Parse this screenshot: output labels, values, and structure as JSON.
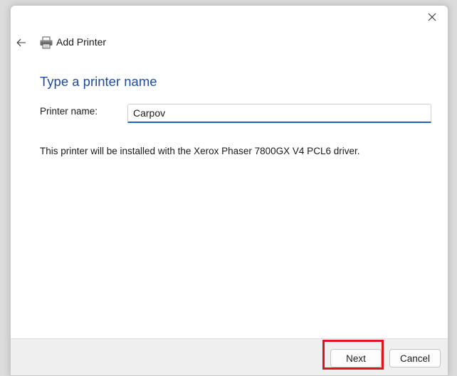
{
  "window": {
    "title": "Add Printer",
    "close_icon": "close-icon",
    "back_icon": "back-arrow-icon",
    "app_icon": "printer-icon"
  },
  "page": {
    "heading": "Type a printer name",
    "field_label": "Printer name:",
    "printer_name_value": "Carpov",
    "driver_info": "This printer will be installed with the Xerox Phaser 7800GX V4 PCL6 driver."
  },
  "footer": {
    "next_label": "Next",
    "cancel_label": "Cancel"
  },
  "colors": {
    "heading": "#1e4b9e",
    "input_focus": "#1f5fbf",
    "highlight": "#e0141c"
  }
}
